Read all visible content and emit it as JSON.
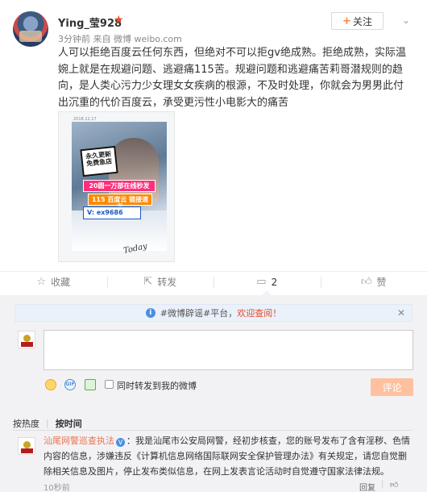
{
  "post": {
    "user_name": "Ying_莹928",
    "vip_icon": "star-icon",
    "time": "3分钟前",
    "source_prefix": "来自",
    "source": "微博 weibo.com",
    "follow_label": "关注",
    "text": "人可以拒绝百度云任何东西，但绝对不可以拒gv绝成熟。拒绝成熟，实际温婉上就是在规避问题、逃避痛115苦。规避问题和逃避痛苦莉哥潜规则的趋向，是人类心污力少女理女女疾病的根源，不及时处理，你就会为男男此付出沉重的代价百度云，承受更污性小电影大的痛苦",
    "image": {
      "date": "2018.12.17",
      "sticker_1": "永久更新 免费急店",
      "sticker_2": "20圆一万部在线秒发",
      "sticker_3": "115 百度云 链接速发",
      "sticker_4": "V: ex9686",
      "signature": "Today"
    }
  },
  "actions": {
    "favorite": "收藏",
    "repost": "转发",
    "comment": "2",
    "like": "赞"
  },
  "notice": {
    "prefix": "#微博辟谣#平台，",
    "link": "欢迎查阅！"
  },
  "composer": {
    "repost_label": "同时转发到我的微博",
    "submit_label": "评论"
  },
  "sort": {
    "hot": "按热度",
    "time": "按时间"
  },
  "comment": {
    "name": "汕尾网警巡查执法",
    "text": "：我是汕尾市公安局网警，经初步核查，您的账号发布了含有淫秽、色情内容的信息，涉嫌违反《计算机信息网络国际联网安全保护管理办法》有关规定，请您自觉删除相关信息及图片，停止发布类似信息，在网上发表言论活动时自觉遵守国家法律法规。",
    "time": "10秒前",
    "reply": "回复",
    "like_icon": "thumb-up-icon"
  }
}
